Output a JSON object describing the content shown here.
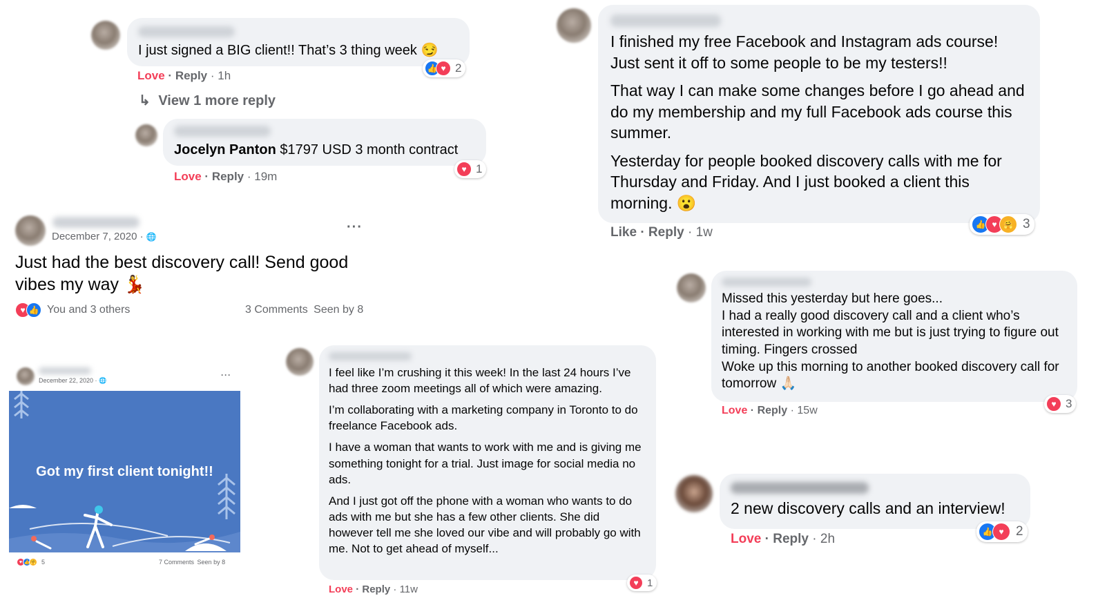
{
  "c1": {
    "text": "I just signed a BIG client!! That’s 3 thing week 😏",
    "love": "Love",
    "reply": "Reply",
    "time": "1h",
    "count": "2",
    "view_more": "View 1 more reply",
    "reply_name": "Jocelyn Panton",
    "reply_text": "$1797 USD 3 month contract",
    "r_love": "Love",
    "r_reply": "Reply",
    "r_time": "19m",
    "r_count": "1"
  },
  "post1": {
    "date": "December 7, 2020 · ",
    "globe": "🌐",
    "dots": "···",
    "text": "Just had the best discovery call! Send good vibes my way 💃",
    "reactions_text": "You and 3 others",
    "comments": "3 Comments",
    "seen": "Seen by 8"
  },
  "post2": {
    "date": "December 22, 2020 · ",
    "globe": "🌐",
    "dots": "···",
    "image_text": "Got my first client tonight!!",
    "count": "5",
    "comments": "7 Comments",
    "seen": "Seen by 8"
  },
  "c2": {
    "p1": "I feel like I’m crushing it this week! In the last 24 hours I’ve had three zoom meetings all of which were amazing.",
    "p2": "I’m collaborating with a marketing company in Toronto to do freelance Facebook ads.",
    "p3": "I have a woman that wants to work with me and is giving me something tonight for a trial. Just image for social media no ads.",
    "p4": "And I just got off the phone with a woman who wants to do ads with me but she has a few other clients. She did however tell me she loved our vibe and will probably go with me. Not to get ahead of myself...",
    "love": "Love",
    "reply": "Reply",
    "time": "11w",
    "count": "1"
  },
  "c3": {
    "p1": "I finished my free Facebook and Instagram ads course! Just sent it off to some people to be my testers!!",
    "p2": "That way I can make some changes before I go ahead and do my membership and my full Facebook ads course this summer.",
    "p3": "Yesterday for people booked discovery calls with me for Thursday and Friday. And I just booked a client this morning. 😮",
    "like": "Like",
    "reply": "Reply",
    "time": "1w",
    "count": "3"
  },
  "c4": {
    "l1": "Missed this yesterday but here goes...",
    "l2": "I had a really good discovery call and a client who’s interested in working with me but is just trying to figure out timing. Fingers crossed",
    "l3": "Woke up this morning to another booked discovery call for tomorrow 🙏🏻",
    "love": "Love",
    "reply": "Reply",
    "time": "15w",
    "count": "3"
  },
  "c5": {
    "text": "2 new discovery calls and an interview!",
    "love": "Love",
    "reply": "Reply",
    "time": "2h",
    "count": "2"
  },
  "sep": "·",
  "arrow": "↳",
  "icons": {
    "like": "👍",
    "love": "♥",
    "care": "🤗"
  }
}
